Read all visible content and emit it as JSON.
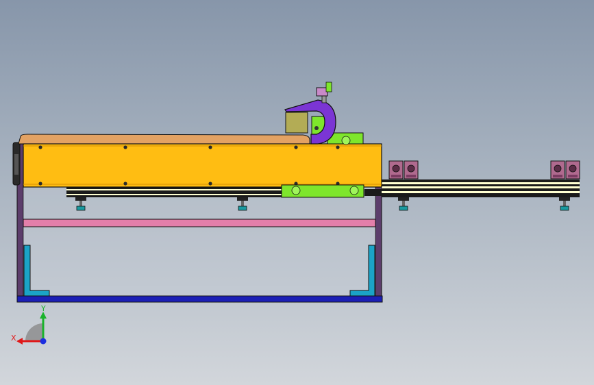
{
  "view": {
    "background_top": "#8796aa",
    "background_bottom": "#d2d6db"
  },
  "colors": {
    "beam_yellow": "#ffbd12",
    "top_plate_tan": "#e3a263",
    "frame_purple": "#5c3d6b",
    "rail_pink": "#e37faa",
    "base_blue": "#1b1fb5",
    "bracket_cyan": "#1ba3c7",
    "carriage_green": "#7ee62c",
    "c_clamp_purple": "#7b35d4",
    "gripper_magenta": "#b06a8f",
    "rail_stripe_cream": "#ffffd1",
    "outline": "#111111"
  },
  "triad": {
    "x_label": "X",
    "y_label": "Y",
    "x_color": "#e01818",
    "y_color": "#1ab32b",
    "z_color": "#1c2fe0"
  },
  "parts": [
    "main-frame",
    "yellow-beam",
    "top-plate",
    "linear-rail",
    "leveling-feet",
    "green-carriage",
    "c-clamp-cylinder",
    "gripper-blocks",
    "pink-crossbar",
    "blue-base",
    "cyan-brackets",
    "end-motor"
  ]
}
